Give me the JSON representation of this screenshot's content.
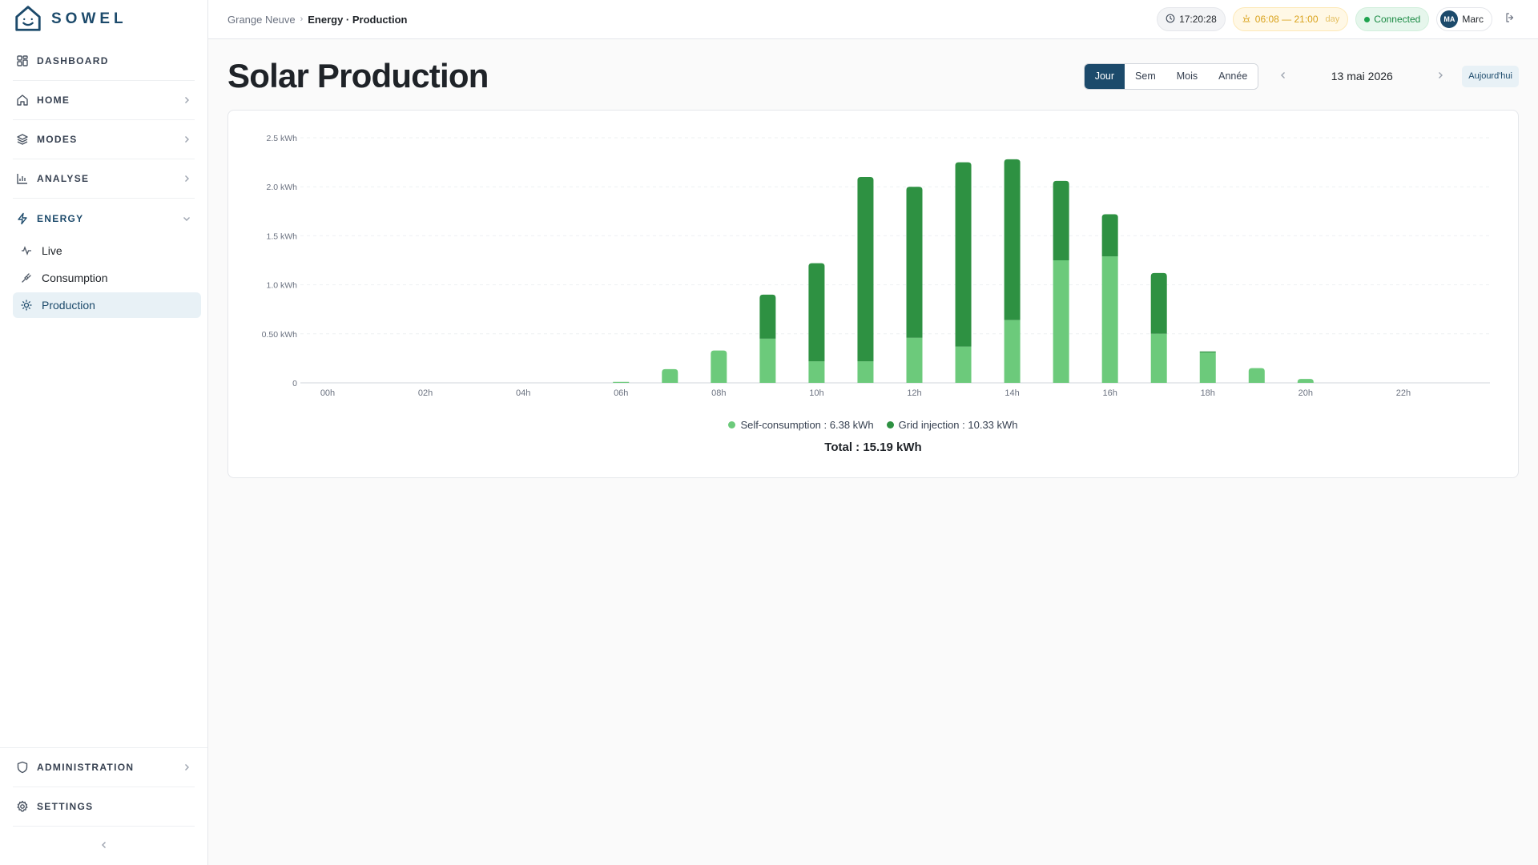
{
  "brand": {
    "name": "SOWEL"
  },
  "sidebar": {
    "items": [
      {
        "label": "DASHBOARD"
      },
      {
        "label": "HOME"
      },
      {
        "label": "MODES"
      },
      {
        "label": "ANALYSE"
      },
      {
        "label": "ENERGY"
      }
    ],
    "energy_sub": [
      {
        "label": "Live"
      },
      {
        "label": "Consumption"
      },
      {
        "label": "Production"
      }
    ],
    "bottom": [
      {
        "label": "ADMINISTRATION"
      },
      {
        "label": "SETTINGS"
      }
    ]
  },
  "topbar": {
    "breadcrumb_root": "Grange Neuve",
    "breadcrumb_current": "Energy · Production",
    "clock": "17:20:28",
    "sun_times": "06:08 — 21:00",
    "sun_tag": "day",
    "status": "Connected",
    "user_initials": "MA",
    "user_name": "Marc"
  },
  "page": {
    "title": "Solar Production",
    "periods": [
      "Jour",
      "Sem",
      "Mois",
      "Année"
    ],
    "active_period": "Jour",
    "date": "13 mai 2026",
    "today_label": "Aujourd'hui"
  },
  "colors": {
    "accent": "#1c4a6b",
    "self_consumption": "#6cca7b",
    "grid_injection": "#2e9142"
  },
  "chart_data": {
    "type": "bar",
    "stacked": true,
    "categories": [
      "00h",
      "01h",
      "02h",
      "03h",
      "04h",
      "05h",
      "06h",
      "07h",
      "08h",
      "09h",
      "10h",
      "11h",
      "12h",
      "13h",
      "14h",
      "15h",
      "16h",
      "17h",
      "18h",
      "19h",
      "20h",
      "21h",
      "22h",
      "23h"
    ],
    "tick_labels": [
      "00h",
      "02h",
      "04h",
      "06h",
      "08h",
      "10h",
      "12h",
      "14h",
      "16h",
      "18h",
      "20h",
      "22h"
    ],
    "y_ticks": [
      "0",
      "0.50 kWh",
      "1.0 kWh",
      "1.5 kWh",
      "2.0 kWh",
      "2.5 kWh"
    ],
    "ylim": [
      0,
      2.5
    ],
    "grid": true,
    "series": [
      {
        "name": "Self-consumption",
        "values": [
          0,
          0,
          0,
          0,
          0,
          0,
          0.01,
          0.14,
          0.33,
          0.45,
          0.22,
          0.22,
          0.46,
          0.37,
          0.64,
          1.25,
          1.29,
          0.5,
          0.31,
          0.15,
          0.04,
          0,
          0,
          0
        ]
      },
      {
        "name": "Grid injection",
        "values": [
          0,
          0,
          0,
          0,
          0,
          0,
          0,
          0,
          0,
          0.45,
          1.0,
          1.88,
          1.54,
          1.88,
          1.64,
          0.81,
          0.43,
          0.62,
          0.01,
          0,
          0,
          0,
          0,
          0
        ]
      }
    ],
    "legend": [
      {
        "label": "Self-consumption : 6.38 kWh"
      },
      {
        "label": "Grid injection : 10.33 kWh"
      }
    ],
    "total_label": "Total : 15.19 kWh"
  }
}
